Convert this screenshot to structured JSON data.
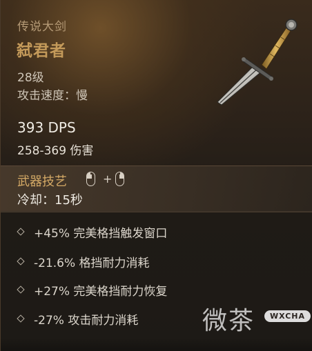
{
  "item": {
    "type": "传说大剑",
    "name": "弑君者",
    "level": "28级",
    "attack_speed": "攻击速度：慢",
    "dps": "393 DPS",
    "damage": "258-369 伤害",
    "image_icon": "greatsword-icon"
  },
  "weapon_skill": {
    "title": "武器技艺",
    "input_icons": [
      "mouse-left-button-icon",
      "mouse-right-button-icon"
    ],
    "plus": "+",
    "cooldown": "冷却：15秒"
  },
  "perks": [
    {
      "text": "+45% 完美格挡触发窗口"
    },
    {
      "text": "-21.6% 格挡耐力消耗"
    },
    {
      "text": "+27% 完美格挡耐力恢复"
    },
    {
      "text": "-27% 攻击耐力消耗"
    }
  ],
  "watermark": {
    "text": "微茶",
    "badge": "WXCHA"
  },
  "colors": {
    "legendary_name": "#c49a5a",
    "skill_title": "#d5aa66",
    "background": "#1f1b16"
  }
}
